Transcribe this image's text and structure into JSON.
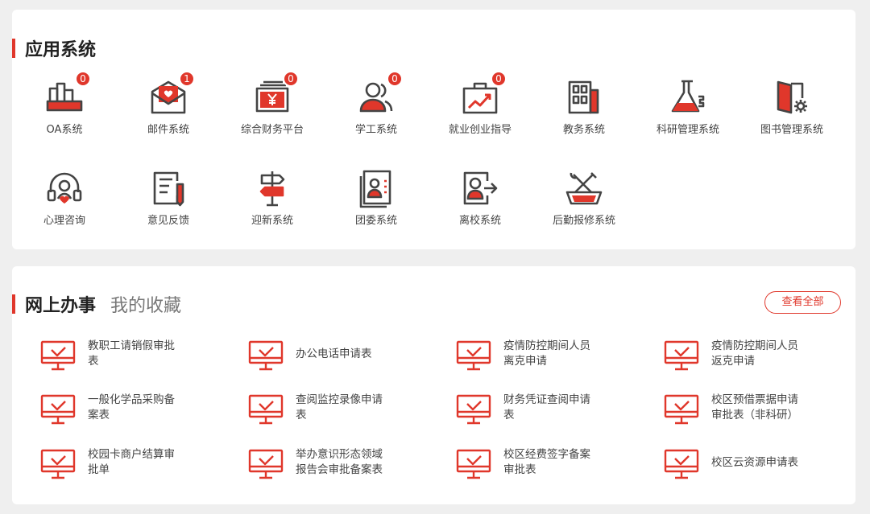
{
  "colors": {
    "accent": "#e0372b",
    "dark": "#444444"
  },
  "apps_section": {
    "title": "应用系统",
    "apps": [
      {
        "label": "OA系统",
        "badge": "0",
        "icon": "oa-buildings-icon"
      },
      {
        "label": "邮件系统",
        "badge": "1",
        "icon": "mail-envelope-icon"
      },
      {
        "label": "综合财务平台",
        "badge": "0",
        "icon": "finance-yen-icon"
      },
      {
        "label": "学工系统",
        "badge": "0",
        "icon": "students-people-icon"
      },
      {
        "label": "就业创业指导",
        "badge": "0",
        "icon": "briefcase-chart-icon"
      },
      {
        "label": "教务系统",
        "badge": null,
        "icon": "office-building-icon"
      },
      {
        "label": "科研管理系统",
        "badge": null,
        "icon": "flask-icon"
      },
      {
        "label": "图书管理系统",
        "badge": null,
        "icon": "library-door-gear-icon"
      },
      {
        "label": "心理咨询",
        "badge": null,
        "icon": "headset-heart-icon"
      },
      {
        "label": "意见反馈",
        "badge": null,
        "icon": "feedback-notepad-icon"
      },
      {
        "label": "迎新系统",
        "badge": null,
        "icon": "signpost-icon"
      },
      {
        "label": "团委系统",
        "badge": null,
        "icon": "profile-card-icon"
      },
      {
        "label": "离校系统",
        "badge": null,
        "icon": "user-exit-icon"
      },
      {
        "label": "后勤报修系统",
        "badge": null,
        "icon": "repair-tools-icon"
      }
    ]
  },
  "office_section": {
    "title": "网上办事",
    "subtitle": "我的收藏",
    "view_all": "查看全部",
    "items": [
      {
        "line1": "教职工请销假审批",
        "line2": "表"
      },
      {
        "line1": "办公电话申请表",
        "line2": ""
      },
      {
        "line1": "疫情防控期间人员",
        "line2": "离克申请"
      },
      {
        "line1": "疫情防控期间人员",
        "line2": "返克申请"
      },
      {
        "line1": "一般化学品采购备",
        "line2": "案表"
      },
      {
        "line1": "查阅监控录像申请",
        "line2": "表"
      },
      {
        "line1": "财务凭证查阅申请",
        "line2": "表"
      },
      {
        "line1": "校区预借票据申请",
        "line2": "审批表（非科研）"
      },
      {
        "line1": "校园卡商户结算审",
        "line2": "批单"
      },
      {
        "line1": "举办意识形态领域",
        "line2": "报告会审批备案表"
      },
      {
        "line1": "校区经费签字备案",
        "line2": "审批表"
      },
      {
        "line1": "校区云资源申请表",
        "line2": ""
      }
    ]
  }
}
